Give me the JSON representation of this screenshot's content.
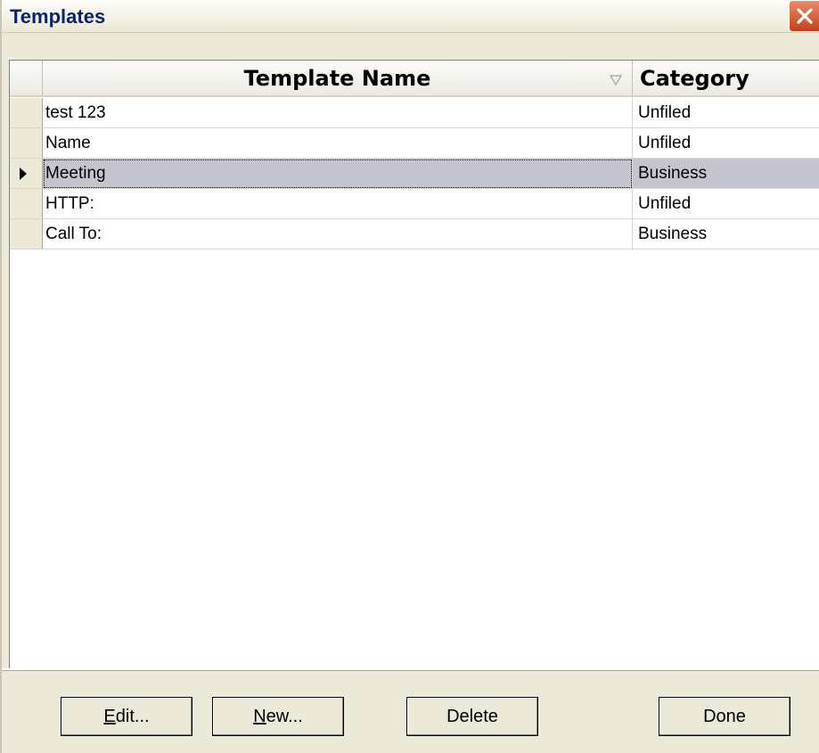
{
  "window": {
    "title": "Templates"
  },
  "grid": {
    "columns": [
      {
        "label": "Template Name",
        "sort_icon": "sort-descending-icon"
      },
      {
        "label": "Category"
      }
    ],
    "rows": [
      {
        "name": "test 123",
        "category": "Unfiled",
        "selected": false
      },
      {
        "name": "Name",
        "category": "Unfiled",
        "selected": false
      },
      {
        "name": "Meeting",
        "category": "Business",
        "selected": true
      },
      {
        "name": "HTTP:",
        "category": "Unfiled",
        "selected": false
      },
      {
        "name": "Call To:",
        "category": "Business",
        "selected": false
      }
    ]
  },
  "buttons": {
    "edit": {
      "mnemonic": "E",
      "rest": "dit..."
    },
    "new": {
      "mnemonic": "N",
      "rest": "ew..."
    },
    "delete": "Delete",
    "done": "Done"
  },
  "colors": {
    "titlebar_text": "#0a246a",
    "close_button": "#d8532f",
    "selected_row": "#c5c5cf",
    "dialog_bg": "#ece9d8"
  }
}
